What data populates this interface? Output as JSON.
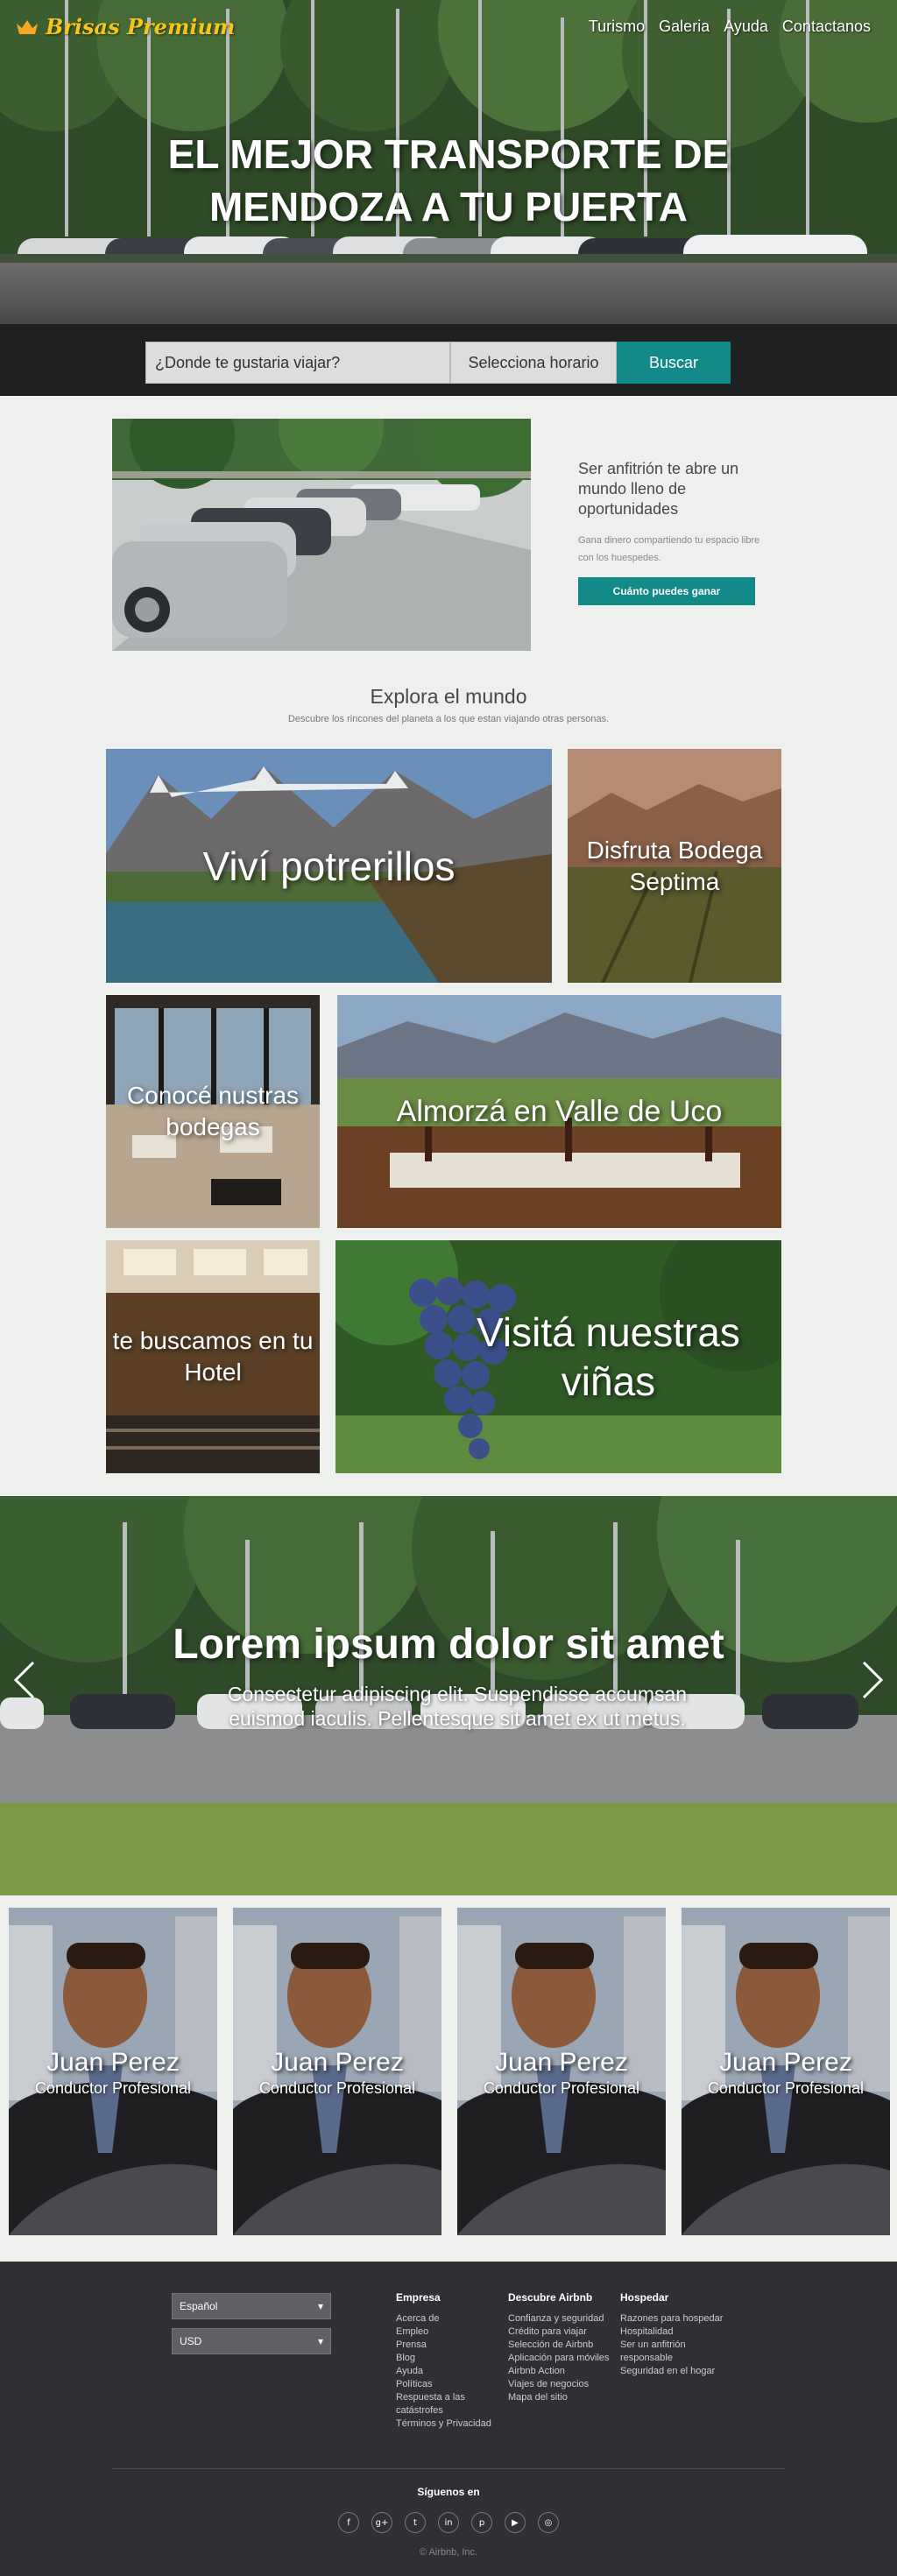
{
  "brand": {
    "name": "Brisas Premium",
    "icon": "crown-icon",
    "color": "#f5c518"
  },
  "nav": [
    "Turismo",
    "Galeria",
    "Ayuda",
    "Contactanos"
  ],
  "hero": {
    "title_line1": "EL MEJOR TRANSPORTE DE",
    "title_line2": "MENDOZA A TU PUERTA"
  },
  "search": {
    "placeholder": "¿Donde te gustaria viajar?",
    "schedule_label": "Selecciona horario",
    "button_label": "Buscar"
  },
  "host": {
    "title": "Ser anfitrión te abre un mundo lleno de oportunidades",
    "subtitle": "Gana dinero compartiendo tu espacio libre con los huespedes.",
    "button_label": "Cuánto puedes ganar"
  },
  "explore": {
    "title": "Explora el mundo",
    "subtitle": "Descubre los rincones del planeta a los que estan viajando otras personas."
  },
  "tiles": [
    {
      "label": "Viví potrerillos"
    },
    {
      "label": "Disfruta Bodega Septima"
    },
    {
      "label": "Conocé nustras bodegas"
    },
    {
      "label": "Almorzá en Valle de Uco"
    },
    {
      "label": "te buscamos en tu Hotel"
    },
    {
      "label": "Visitá nuestras viñas"
    }
  ],
  "slider": {
    "title": "Lorem ipsum dolor sit amet",
    "text": "Consectetur adipiscing elit. Suspendisse accumsan euismod iaculis. Pellentesque sit amet ex ut metus."
  },
  "drivers": [
    {
      "name": "Juan Perez",
      "role": "Conductor Profesional"
    },
    {
      "name": "Juan Perez",
      "role": "Conductor Profesional"
    },
    {
      "name": "Juan Perez",
      "role": "Conductor Profesional"
    },
    {
      "name": "Juan Perez",
      "role": "Conductor Profesional"
    }
  ],
  "footer": {
    "language": "Español",
    "currency": "USD",
    "columns": [
      {
        "title": "Empresa",
        "items": [
          "Acerca de",
          "Empleo",
          "Prensa",
          "Blog",
          "Ayuda",
          "Políticas",
          "Respuesta a las",
          "catástrofes",
          "Términos y Privacidad"
        ]
      },
      {
        "title": "Descubre Airbnb",
        "items": [
          "Confianza y seguridad",
          "Crédito para viajar",
          "Selección de Airbnb",
          "Aplicación para móviles",
          "Airbnb Action",
          "Viajes de negocios",
          "Mapa del sitio"
        ]
      },
      {
        "title": "Hospedar",
        "items": [
          "Razones para hospedar",
          "Hospitalidad",
          "Ser un anfitrión",
          "responsable",
          "Seguridad en el hogar"
        ]
      }
    ],
    "follow": "Síguenos en",
    "socials": [
      {
        "icon": "facebook-icon",
        "glyph": "f"
      },
      {
        "icon": "google-plus-icon",
        "glyph": "g+"
      },
      {
        "icon": "twitter-icon",
        "glyph": "t"
      },
      {
        "icon": "linkedin-icon",
        "glyph": "in"
      },
      {
        "icon": "pinterest-icon",
        "glyph": "p"
      },
      {
        "icon": "youtube-icon",
        "glyph": "▶"
      },
      {
        "icon": "instagram-icon",
        "glyph": "◎"
      }
    ],
    "copyright": "© Airbnb, Inc."
  },
  "colors": {
    "accent": "#138a8a",
    "footer": "#2e3033"
  }
}
